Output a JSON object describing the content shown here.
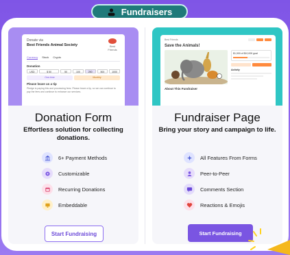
{
  "header": {
    "title": "Fundraisers",
    "icon": "user-icon"
  },
  "cards": [
    {
      "title": "Donation Form",
      "subtitle": "Effortless solution for collecting donations.",
      "features": [
        {
          "label": "6+ Payment Methods",
          "icon": "bank-icon",
          "color": "#dfe3ff"
        },
        {
          "label": "Customizable",
          "icon": "gear-icon",
          "color": "#e6dcfb"
        },
        {
          "label": "Recurring Donations",
          "icon": "calendar-icon",
          "color": "#fde0ea"
        },
        {
          "label": "Embeddable",
          "icon": "embed-icon",
          "color": "#fff0c9"
        }
      ],
      "button": "Start Fundraising"
    },
    {
      "title": "Fundraiser Page",
      "subtitle": "Bring your story and campaign to life.",
      "features": [
        {
          "label": "All Features From Forms",
          "icon": "sparkle-icon",
          "color": "#dfe3ff"
        },
        {
          "label": "Peer-to-Peer",
          "icon": "person-icon",
          "color": "#e6dcfb"
        },
        {
          "label": "Comments Section",
          "icon": "chat-icon",
          "color": "#e3dcfb"
        },
        {
          "label": "Reactions & Emojis",
          "icon": "heart-icon",
          "color": "#fde0ea"
        }
      ],
      "button": "Start Fundraising"
    }
  ],
  "donation_preview": {
    "donate_via": "Donate via",
    "org": "Best Friends Animal Society",
    "logo_text": "Best Friends",
    "tabs": [
      "Currency",
      "Stock",
      "Crypto"
    ],
    "donation_label": "Donation",
    "currency": "USD",
    "amount": "$ 50",
    "presets": [
      "50",
      "100",
      "250",
      "500",
      "1000"
    ],
    "one_time": "One-time",
    "monthly": "Monthly",
    "tip_label": "Please leave us a tip",
    "tip_text": "Pledge is paying this and processing fees. Please leave a tip, so we can continue to pay the fees and continue to enhance our services."
  },
  "page_preview": {
    "org_label": "Best Friends",
    "title": "Save the Animals!",
    "raised": "$1,000 of $10,000 goal",
    "activity": "Activity",
    "about": "About This Fundraiser"
  },
  "colors": {
    "accent": "#7a55e2",
    "background_purple": "#8d63ec",
    "teal": "#1f7a7a"
  }
}
